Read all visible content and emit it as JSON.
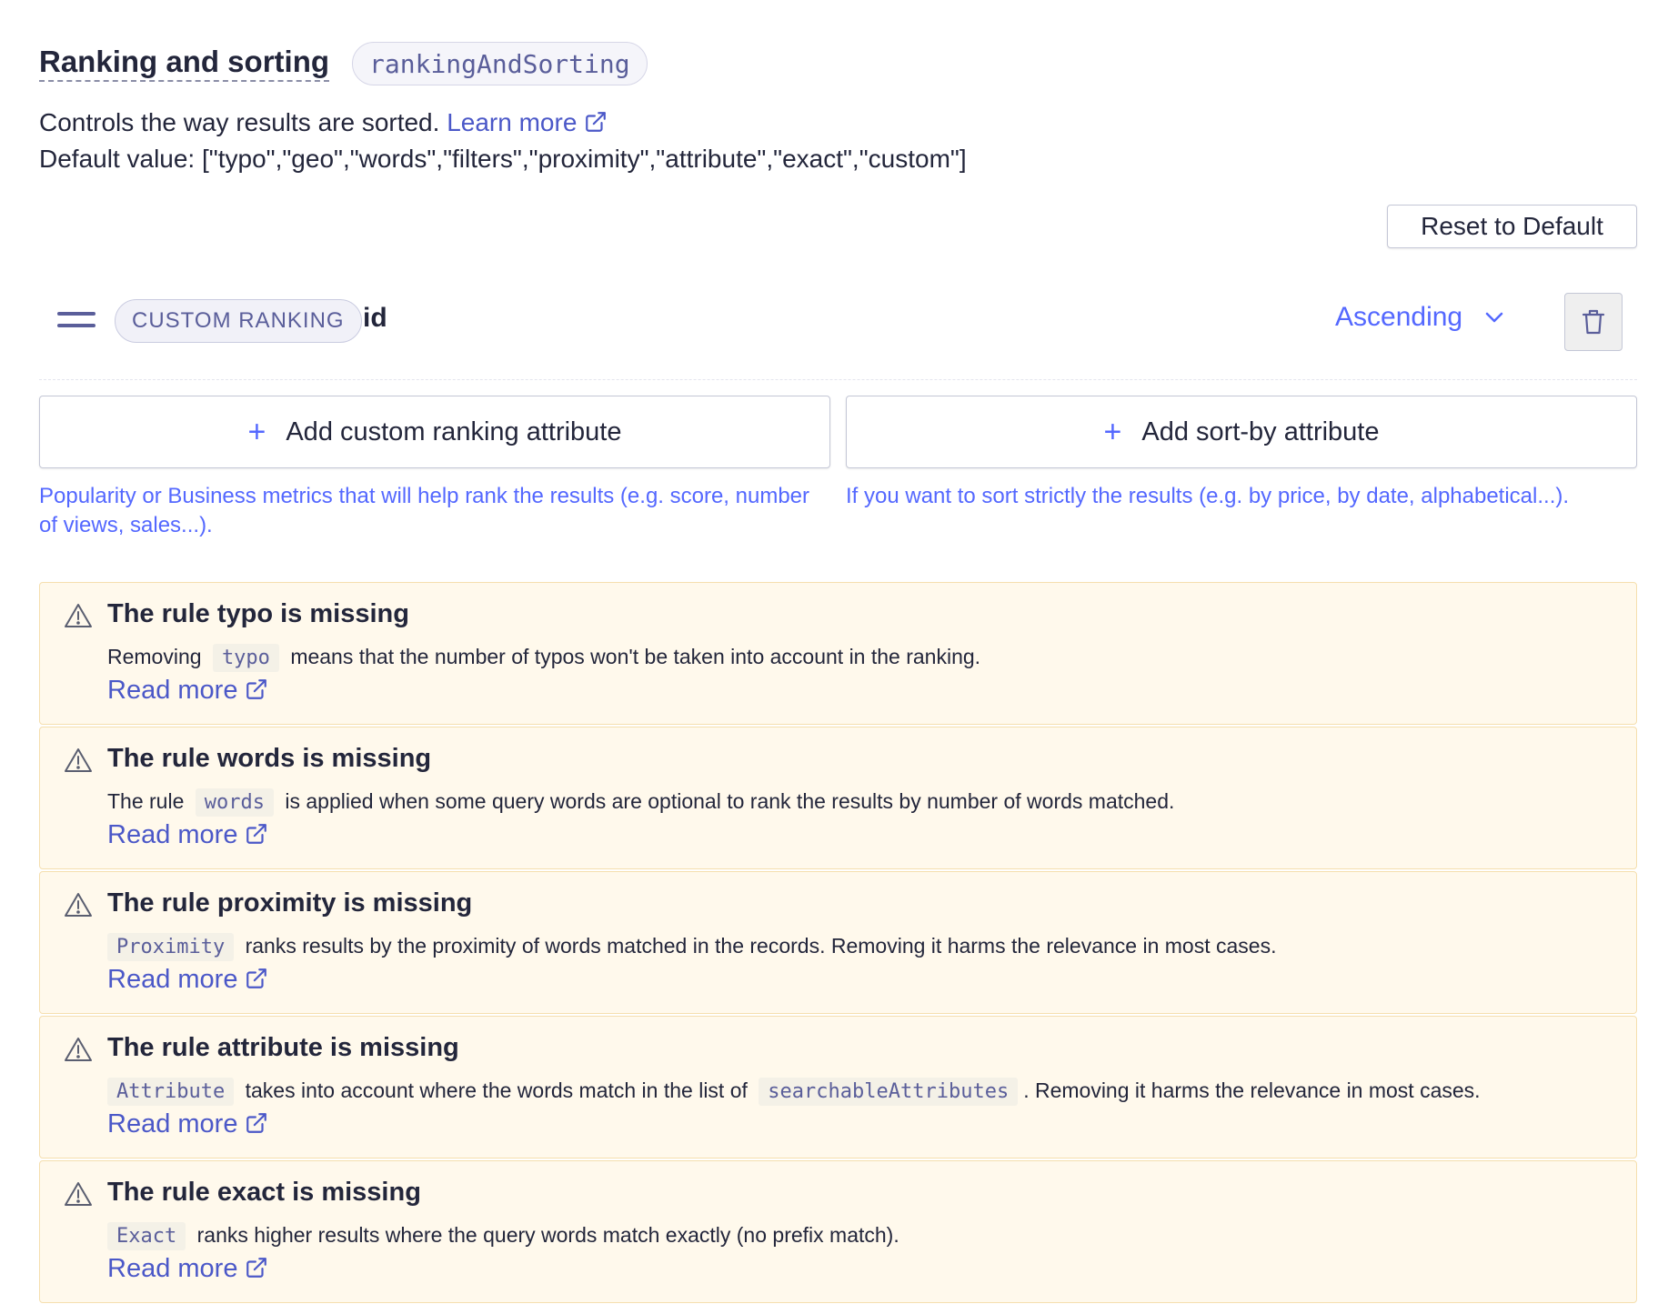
{
  "header": {
    "title": "Ranking and sorting",
    "key": "rankingAndSorting",
    "description": "Controls the way results are sorted.",
    "learn_more": "Learn more",
    "default_value": "Default value: [\"typo\",\"geo\",\"words\",\"filters\",\"proximity\",\"attribute\",\"exact\",\"custom\"]"
  },
  "reset_label": "Reset to Default",
  "ranking_row": {
    "chip": "CUSTOM RANKING",
    "attribute": "id",
    "order": "Ascending"
  },
  "add_custom": {
    "label": "Add custom ranking attribute",
    "help": "Popularity or Business metrics that will help rank the results (e.g. score, number of views, sales...)."
  },
  "add_sort": {
    "label": "Add sort-by attribute",
    "help": "If you want to sort strictly the results (e.g. by price, by date, alphabetical...)."
  },
  "warnings": [
    {
      "title": "The rule typo is missing",
      "pre": "Removing",
      "code": "typo",
      "post": "means that the number of typos won't be taken into account in the ranking.",
      "read_more": "Read more"
    },
    {
      "title": "The rule words is missing",
      "pre": "The rule",
      "code": "words",
      "post": "is applied when some query words are optional to rank the results by number of words matched.",
      "read_more": "Read more"
    },
    {
      "title": "The rule proximity is missing",
      "pre": "",
      "code": "Proximity",
      "post": "ranks results by the proximity of words matched in the records. Removing it harms the relevance in most cases.",
      "read_more": "Read more"
    },
    {
      "title": "The rule attribute is missing",
      "pre": "",
      "code": "Attribute",
      "mid": "takes into account where the words match in the list of",
      "code2": "searchableAttributes",
      "post": ". Removing it harms the relevance in most cases.",
      "read_more": "Read more"
    },
    {
      "title": "The rule exact is missing",
      "pre": "",
      "code": "Exact",
      "post": "ranks higher results where the query words match exactly (no prefix match).",
      "read_more": "Read more"
    }
  ],
  "icons": {
    "external_link": "external-link-icon",
    "drag": "drag-handle-icon",
    "chevron": "chevron-down-icon",
    "trash": "trash-icon",
    "plus": "plus-icon",
    "warning": "warning-icon"
  },
  "colors": {
    "accent": "#5468ff",
    "warning_bg": "#fff9ec",
    "warning_border": "#f5dfae"
  }
}
